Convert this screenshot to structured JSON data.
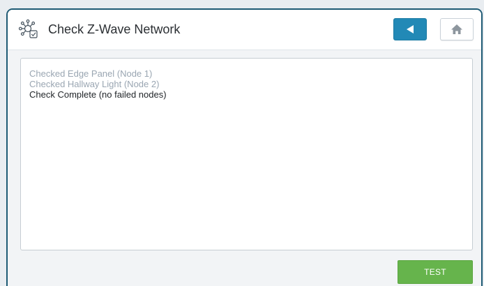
{
  "header": {
    "title": "Check Z-Wave Network",
    "icon": "network-check-icon"
  },
  "nav": {
    "back_icon": "back-arrow-icon",
    "home_icon": "home-icon"
  },
  "log": {
    "lines": [
      {
        "text": "Checked Edge Panel (Node 1)",
        "state": "faded"
      },
      {
        "text": "Checked Hallway Light (Node 2)",
        "state": "faded"
      },
      {
        "text": "Check Complete (no failed nodes)",
        "state": "current"
      }
    ]
  },
  "actions": {
    "test_label": "TEST"
  },
  "colors": {
    "accent": "#2289b6",
    "success": "#66b44c",
    "frame_border": "#1e5a74"
  }
}
